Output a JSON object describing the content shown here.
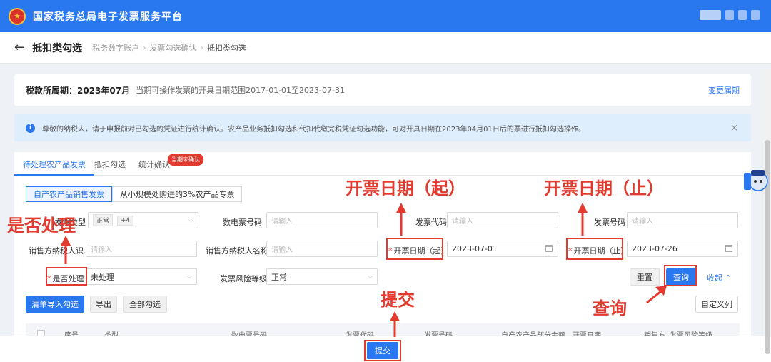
{
  "app": {
    "title": "国家税务总局电子发票服务平台",
    "logo_icon": "tax-emblem-icon"
  },
  "page": {
    "title": "抵扣类勾选",
    "breadcrumb": [
      "税务数字账户",
      "发票勾选确认",
      "抵扣类勾选"
    ]
  },
  "period": {
    "label": "税款所属期：2023年07月",
    "range_text": "当期可操作发票的开具日期范围2017-01-01至2023-07-31",
    "change_link": "变更属期"
  },
  "notice": {
    "text": "尊敬的纳税人，请于申报前对已勾选的凭证进行统计确认。农产品业务抵扣勾选和代扣代缴完税凭证勾选功能，可对开具日期在2023年04月01日后的票进行抵扣勾选操作。",
    "close": "×"
  },
  "tabs": [
    {
      "label": "待处理农产品发票",
      "active": true
    },
    {
      "label": "抵扣勾选",
      "active": false
    },
    {
      "label": "统计确认",
      "active": false
    }
  ],
  "tab_badge": "当期未确认",
  "subtabs": [
    {
      "label": "自产农产品销售发票",
      "active": true
    },
    {
      "label": "从小规模处购进的3%农产品专票",
      "active": false
    }
  ],
  "form": {
    "invoice_type_label": "发票类型",
    "invoice_type_tags": [
      "正常",
      "+4"
    ],
    "digital_no_label": "数电票号码",
    "digital_no_placeholder": "请输入",
    "invoice_code_label": "发票代码",
    "invoice_code_placeholder": "请输入",
    "invoice_no_label": "发票号码",
    "invoice_no_placeholder": "请输入",
    "seller_tax_id_label": "销售方纳税人识...",
    "seller_tax_id_placeholder": "请输入",
    "seller_name_label": "销售方纳税人名称",
    "seller_name_placeholder": "请输入",
    "date_start_label": "开票日期（起）",
    "date_start_value": "2023-07-01",
    "date_end_label": "开票日期（止）",
    "date_end_value": "2023-07-26",
    "processed_label": "是否处理",
    "processed_value": "未处理",
    "risk_label": "发票风险等级",
    "risk_value": "正常",
    "required_mark": "*"
  },
  "buttons": {
    "reset": "重置",
    "query": "查询",
    "collapse": "收起",
    "import_select": "清单导入勾选",
    "export": "导出",
    "select_all": "全部勾选",
    "custom_columns": "自定义列",
    "submit": "提交"
  },
  "table": {
    "headers": [
      "序号",
      "类型",
      "数电票号码",
      "发票代码",
      "发票号码",
      "自产农产品部分金额",
      "开票日期",
      "销售方",
      "发票风险等级"
    ]
  },
  "annotations": {
    "processed": "是否处理",
    "date_start": "开票日期（起）",
    "date_end": "开票日期（止）",
    "submit": "提交",
    "query": "查询"
  },
  "colors": {
    "accent": "#2a78f0",
    "annotation": "#e23a2e",
    "topbar": "#2a78f0"
  }
}
